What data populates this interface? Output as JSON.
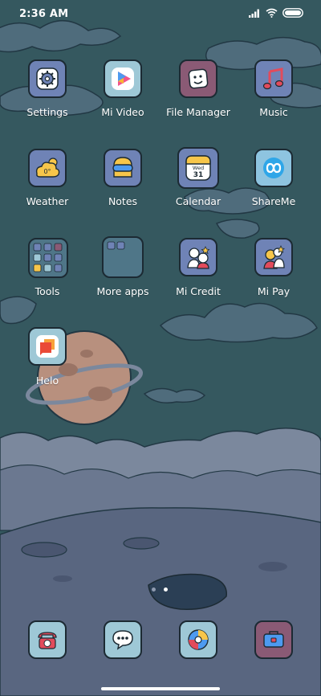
{
  "status_bar": {
    "time": "2:36 AM"
  },
  "home_grid": [
    {
      "label": "Settings",
      "icon": "gear-icon",
      "color": "#6f83b6"
    },
    {
      "label": "Mi Video",
      "icon": "play-triangle-icon",
      "color": "#9ec8d6"
    },
    {
      "label": "File Manager",
      "icon": "folder-face-icon",
      "color": "#8a5a75"
    },
    {
      "label": "Music",
      "icon": "music-note-icon",
      "color": "#6f83b6"
    },
    {
      "label": "Weather",
      "icon": "weather-cloud-icon",
      "color": "#6f83b6"
    },
    {
      "label": "Notes",
      "icon": "notes-goggles-icon",
      "color": "#6f83b6"
    },
    {
      "label": "Calendar",
      "icon": "calendar-icon",
      "color": "#6f83b6"
    },
    {
      "label": "ShareMe",
      "icon": "infinity-icon",
      "color": "#8ec4e0"
    },
    {
      "label": "Tools",
      "icon": "folder-icon",
      "color": "#4f7688"
    },
    {
      "label": "More apps",
      "icon": "folder-icon",
      "color": "#4f7688"
    },
    {
      "label": "Mi Credit",
      "icon": "characters-icon",
      "color": "#6f83b6"
    },
    {
      "label": "Mi Pay",
      "icon": "characters-icon",
      "color": "#6f83b6"
    },
    {
      "label": "Helo",
      "icon": "chat-bubble-icon",
      "color": "#9ec8d6"
    }
  ],
  "calendar_icon": {
    "weekday": "Wed",
    "day": "31"
  },
  "weather_icon": {
    "temp": "0°"
  },
  "dock": [
    {
      "icon": "phone-icon",
      "color": "#9ec8d6"
    },
    {
      "icon": "message-bubble-icon",
      "color": "#9ec8d6"
    },
    {
      "icon": "browser-ball-icon",
      "color": "#9ec8d6"
    },
    {
      "icon": "toolbox-icon",
      "color": "#8a5a75"
    }
  ],
  "page_indicator": {
    "pages": 2,
    "current": 2
  },
  "colors": {
    "sky": "#35585f",
    "clouds": "#7b889d",
    "ground": "#596680",
    "planet": "#b8907e",
    "active_dot": "#ffffff",
    "inactive_dot": "#8f9bb0"
  }
}
